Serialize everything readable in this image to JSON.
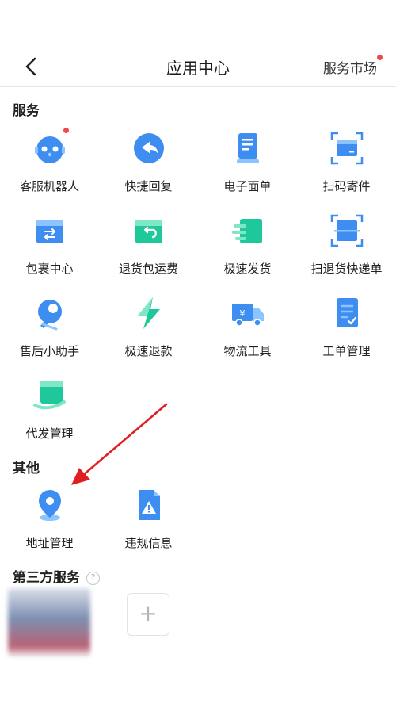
{
  "header": {
    "title": "应用中心",
    "market_label": "服务市场"
  },
  "sections": {
    "service": {
      "title": "服务",
      "items": [
        {
          "label": "客服机器人",
          "icon": "robot-icon"
        },
        {
          "label": "快捷回复",
          "icon": "reply-icon"
        },
        {
          "label": "电子面单",
          "icon": "e-waybill-icon"
        },
        {
          "label": "扫码寄件",
          "icon": "scan-package-icon"
        },
        {
          "label": "包裹中心",
          "icon": "package-icon"
        },
        {
          "label": "退货包运费",
          "icon": "return-freight-icon"
        },
        {
          "label": "极速发货",
          "icon": "fast-ship-icon"
        },
        {
          "label": "扫退货快递单",
          "icon": "scan-return-icon"
        },
        {
          "label": "售后小助手",
          "icon": "wrench-icon"
        },
        {
          "label": "极速退款",
          "icon": "lightning-icon"
        },
        {
          "label": "物流工具",
          "icon": "truck-icon"
        },
        {
          "label": "工单管理",
          "icon": "work-order-icon"
        },
        {
          "label": "代发管理",
          "icon": "dropship-icon"
        }
      ]
    },
    "other": {
      "title": "其他",
      "items": [
        {
          "label": "地址管理",
          "icon": "location-pin-icon"
        },
        {
          "label": "违规信息",
          "icon": "warning-doc-icon"
        }
      ]
    },
    "third_party": {
      "title": "第三方服务",
      "help_glyph": "?",
      "add_glyph": "+"
    }
  },
  "colors": {
    "blue": "#3d8ef0",
    "blue_light": "#8cc4ff",
    "green": "#1ec89a",
    "red_dot": "#f0484d",
    "arrow": "#e02020"
  }
}
